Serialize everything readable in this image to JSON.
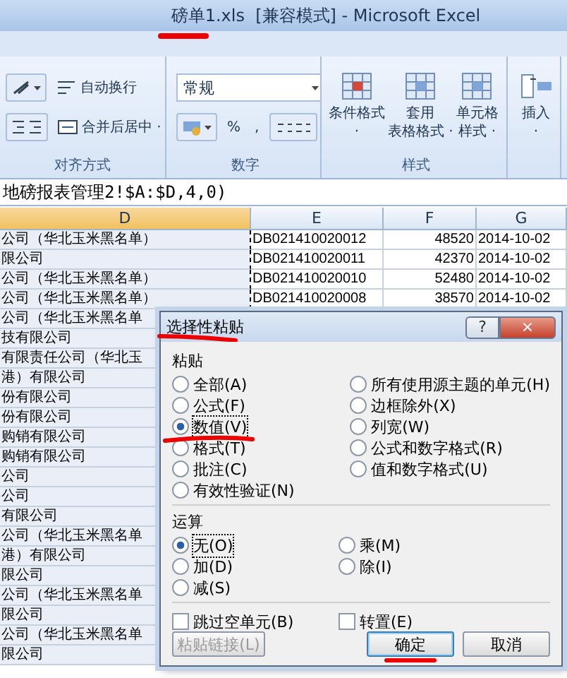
{
  "window": {
    "title": "磅单1.xls  [兼容模式] - Microsoft Excel"
  },
  "ribbon": {
    "groups": [
      {
        "kind": "alignment",
        "label": "对齐方式",
        "wrap": "自动换行",
        "merge": "合并后居中 ·"
      },
      {
        "kind": "number",
        "label": "数字",
        "format": "常规",
        "percent": "%",
        "comma": ","
      },
      {
        "kind": "styles",
        "label": "样式",
        "buttons": [
          {
            "line1": "条件格式",
            "line2": "·"
          },
          {
            "line1": "套用",
            "line2": "表格格式 ·"
          },
          {
            "line1": "单元格",
            "line2": "样式 ·"
          }
        ]
      },
      {
        "kind": "cells",
        "buttons": [
          {
            "line1": "插入",
            "line2": "·"
          }
        ]
      }
    ]
  },
  "formula": "地磅报表管理2!$A:$D,4,0)",
  "columns": [
    {
      "label": "D",
      "selected": true
    },
    {
      "label": "E",
      "selected": false
    },
    {
      "label": "F",
      "selected": false
    },
    {
      "label": "G",
      "selected": false
    }
  ],
  "rows": [
    {
      "d": "公司（华北玉米黑名单）",
      "e": "DB021410020012",
      "f": "48520",
      "g": "2014-10-02"
    },
    {
      "d": "限公司",
      "e": "DB021410020011",
      "f": "42370",
      "g": "2014-10-02"
    },
    {
      "d": "公司（华北玉米黑名单）",
      "e": "DB021410020010",
      "f": "52480",
      "g": "2014-10-02"
    },
    {
      "d": "公司（华北玉米黑名单）",
      "e": "DB021410020008",
      "f": "38570",
      "g": "2014-10-02"
    },
    {
      "d": "公司（华北玉米黑名单"
    },
    {
      "d": "技有限公司"
    },
    {
      "d": "有限责任公司（华北玉"
    },
    {
      "d": "港）有限公司"
    },
    {
      "d": "份有限公司"
    },
    {
      "d": "份有限公司"
    },
    {
      "d": "购销有限公司"
    },
    {
      "d": "购销有限公司"
    },
    {
      "d": "公司"
    },
    {
      "d": "公司"
    },
    {
      "d": "有限公司"
    },
    {
      "d": "公司（华北玉米黑名单"
    },
    {
      "d": "港）有限公司"
    },
    {
      "d": "限公司"
    },
    {
      "d": "公司（华北玉米黑名单"
    },
    {
      "d": "限公司"
    },
    {
      "d": "公司（华北玉米黑名单"
    },
    {
      "d": "限公司"
    }
  ],
  "dialog": {
    "title": "选择性粘贴",
    "help": "?",
    "close": "×",
    "paste_label": "粘贴",
    "paste_left": [
      {
        "label": "全部(A)",
        "selected": false
      },
      {
        "label": "公式(F)",
        "selected": false
      },
      {
        "label": "数值(V)",
        "selected": true
      },
      {
        "label": "格式(T)",
        "selected": false
      },
      {
        "label": "批注(C)",
        "selected": false
      },
      {
        "label": "有效性验证(N)",
        "selected": false
      }
    ],
    "paste_right": [
      {
        "label": "所有使用源主题的单元(H)",
        "selected": false
      },
      {
        "label": "边框除外(X)",
        "selected": false
      },
      {
        "label": "列宽(W)",
        "selected": false
      },
      {
        "label": "公式和数字格式(R)",
        "selected": false
      },
      {
        "label": "值和数字格式(U)",
        "selected": false
      }
    ],
    "operation_label": "运算",
    "operation_left": [
      {
        "label": "无(O)",
        "selected": true
      },
      {
        "label": "加(D)",
        "selected": false
      },
      {
        "label": "减(S)",
        "selected": false
      }
    ],
    "operation_right": [
      {
        "label": "乘(M)",
        "selected": false
      },
      {
        "label": "除(I)",
        "selected": false
      }
    ],
    "checkboxes": [
      {
        "label": "跳过空单元(B)",
        "checked": false
      },
      {
        "label": "转置(E)",
        "checked": false
      }
    ],
    "buttons": [
      {
        "label": "粘贴链接(L)",
        "disabled": true,
        "focused": false
      },
      {
        "label": "确定",
        "disabled": false,
        "focused": true
      },
      {
        "label": "取消",
        "disabled": false,
        "focused": false
      }
    ]
  }
}
